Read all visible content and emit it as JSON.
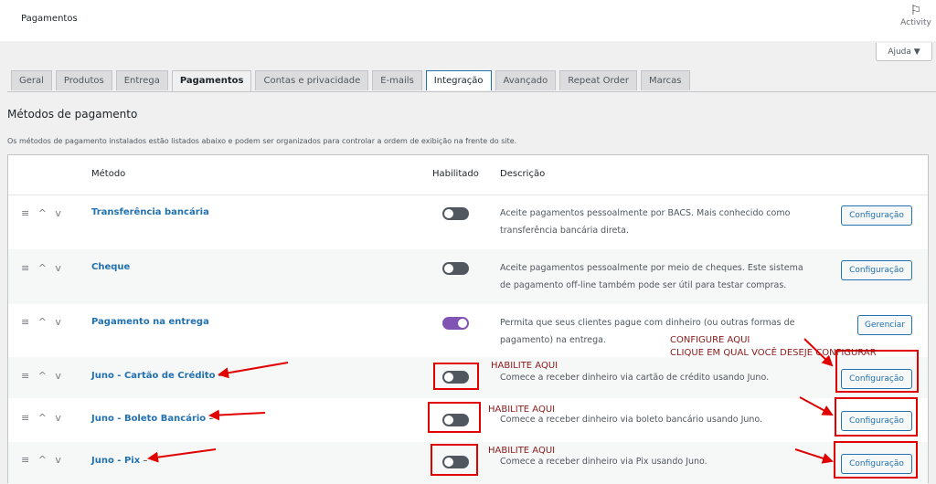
{
  "header": {
    "title": "Pagamentos",
    "activity_label": "Activity",
    "activity_icon": "flag-icon"
  },
  "help": {
    "label": "Ajuda ▼"
  },
  "tabs": [
    {
      "label": "Geral"
    },
    {
      "label": "Produtos"
    },
    {
      "label": "Entrega"
    },
    {
      "label": "Pagamentos"
    },
    {
      "label": "Contas e privacidade"
    },
    {
      "label": "E-mails"
    },
    {
      "label": "Integração"
    },
    {
      "label": "Avançado"
    },
    {
      "label": "Repeat Order"
    },
    {
      "label": "Marcas"
    }
  ],
  "section": {
    "title": "Métodos de pagamento",
    "description": "Os métodos de pagamento instalados estão listados abaixo e podem ser organizados para controlar a ordem de exibição na frente do site."
  },
  "table": {
    "headers": {
      "method": "Método",
      "enabled": "Habilitado",
      "description": "Descrição"
    },
    "sort_glyph": "≡ ^ v",
    "rows": [
      {
        "name": "Transferência bancária",
        "suffix": "",
        "enabled": false,
        "description": "Aceite pagamentos pessoalmente por BACS. Mais conhecido como transferência bancária direta.",
        "action": "Configuração"
      },
      {
        "name": "Cheque",
        "suffix": "",
        "enabled": false,
        "description": "Aceite pagamentos pessoalmente por meio de cheques. Este sistema de pagamento off-line também pode ser útil para testar compras.",
        "action": "Configuração"
      },
      {
        "name": "Pagamento na entrega",
        "suffix": "",
        "enabled": true,
        "description": "Permita que seus clientes pague com dinheiro (ou outras formas de pagamento) na entrega.",
        "action": "Gerenciar"
      },
      {
        "name": "Juno - Cartão de Crédito",
        "suffix": " –",
        "enabled": false,
        "description": "Comece a receber dinheiro via cartão de crédito usando Juno.",
        "action": "Configuração"
      },
      {
        "name": "Juno - Boleto Bancário",
        "suffix": " –",
        "enabled": false,
        "description": "Comece a receber dinheiro via boleto bancário usando Juno.",
        "action": "Configuração"
      },
      {
        "name": "Juno - Pix",
        "suffix": " –",
        "enabled": false,
        "description": "Comece a receber dinheiro via Pix usando Juno.",
        "action": "Configuração"
      }
    ]
  },
  "annotations": {
    "enable_1": "HABILITE AQUI",
    "enable_2": "HABILITE AQUI",
    "enable_3": "HABILITE AQUI",
    "configure_line1": "CONFIGURE AQUI",
    "configure_line2": "CLIQUE EM QUAL VOCÊ DESEJE CONFIGURAR",
    "color": "#e00000"
  }
}
